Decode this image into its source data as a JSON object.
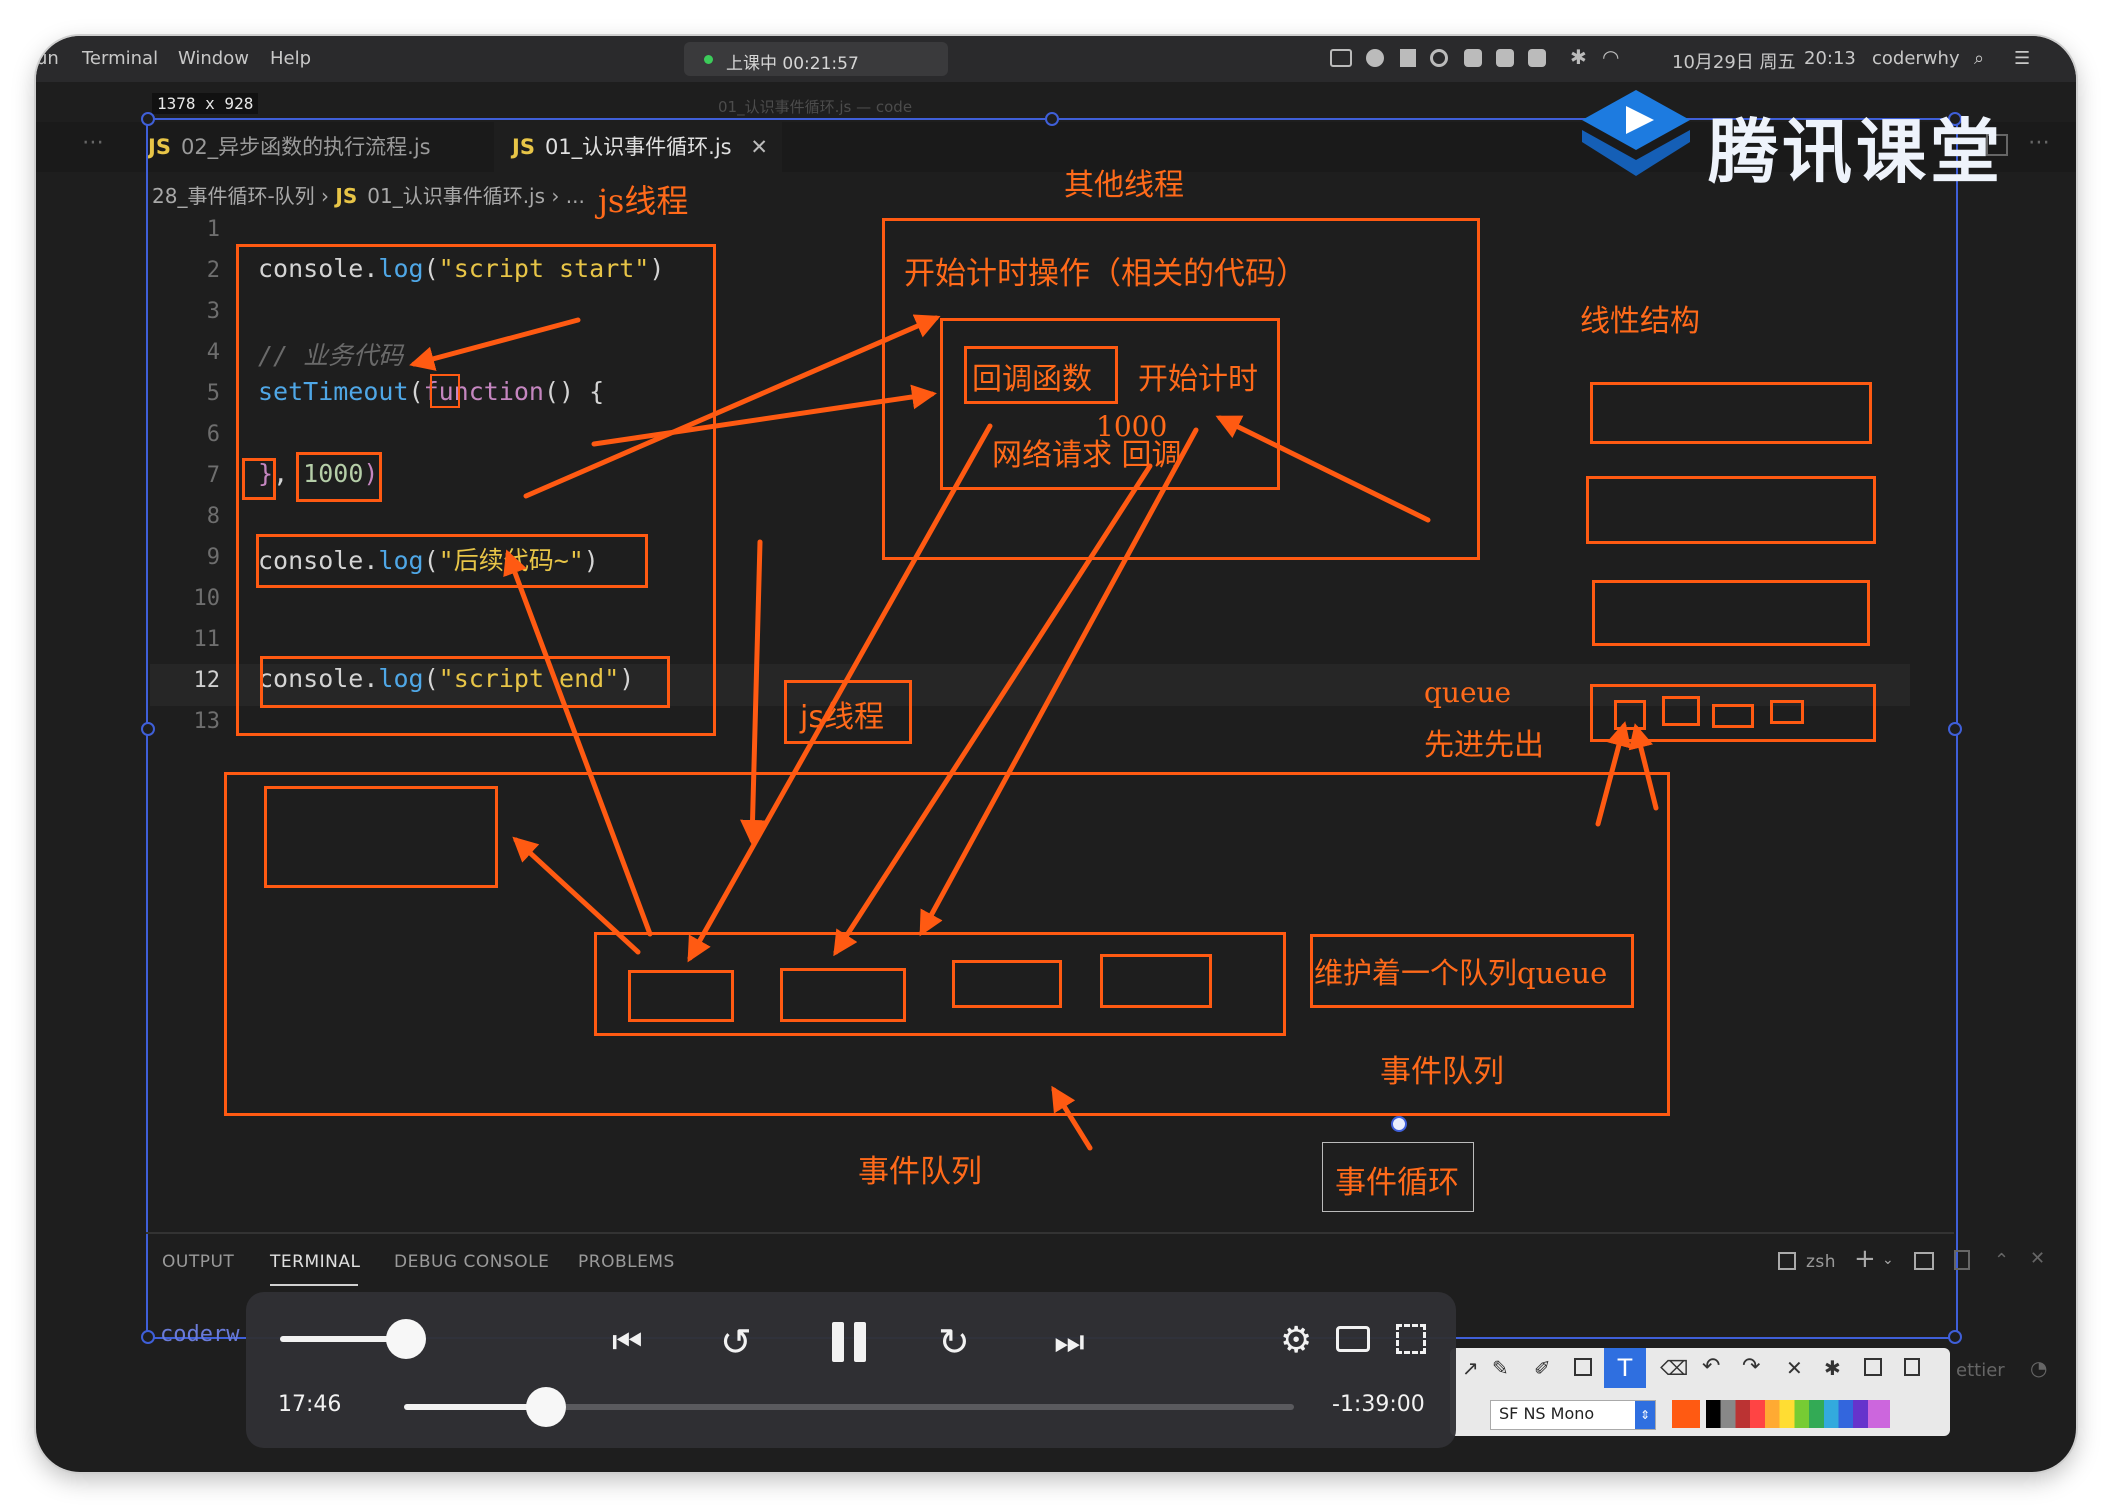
{
  "menubar": {
    "partial_left": "un",
    "terminal": "Terminal",
    "window": "Window",
    "help": "Help",
    "recording": "上课中 00:21:57",
    "date": "10月29日 周五",
    "time": "20:13",
    "user": "coderwhy"
  },
  "window_title": "01_认识事件循环.js — code",
  "canvas_size": "1378 x 928",
  "logo_text": "腾讯课堂",
  "editor": {
    "tabs": [
      {
        "label": "02_异步函数的执行流程.js"
      },
      {
        "label": "01_认识事件循环.js"
      }
    ],
    "breadcrumb": {
      "folder": "28_事件循环-队列",
      "file": "01_认识事件循环.js",
      "rest": "..."
    },
    "line_numbers": [
      "1",
      "2",
      "3",
      "4",
      "5",
      "6",
      "7",
      "8",
      "9",
      "10",
      "11",
      "12",
      "13"
    ],
    "code": {
      "l2_a": "console.",
      "l2_b": "log",
      "l2_c": "(",
      "l2_d": "\"script start\"",
      "l2_e": ")",
      "l4": "// 业务代码",
      "l5_a": "setTimeout",
      "l5_b": "(",
      "l5_c": "function",
      "l5_d": "() {",
      "l7_a": "}",
      "l7_b": ", ",
      "l7_c": "1000",
      "l7_d": ")",
      "l9_a": "console.",
      "l9_b": "log",
      "l9_c": "(",
      "l9_d": "\"后续代码~\"",
      "l9_e": ")",
      "l12_a": "console.",
      "l12_b": "log",
      "l12_c": "(",
      "l12_d": "\"script end\"",
      "l12_e": ")"
    }
  },
  "annotations": {
    "js_thread_top": "js线程",
    "other_threads": "其他线程",
    "timer_op": "开始计时操作（相关的代码）",
    "callback": "回调函数",
    "start_timer": "开始计时",
    "n1000": "1000",
    "network_callback": "网络请求 回调",
    "linear": "线性结构",
    "queue": "queue",
    "fifo": "先进先出",
    "js_thread_mid": "js线程",
    "maintain_queue": "维护着一个队列queue",
    "event_queue_right": "事件队列",
    "event_queue_bottom": "事件队列",
    "event_loop": "事件循环"
  },
  "panel": {
    "tabs": [
      "OUTPUT",
      "TERMINAL",
      "DEBUG CONSOLE",
      "PROBLEMS"
    ],
    "active_tab": "TERMINAL",
    "shell": "zsh",
    "prompt": "coderw"
  },
  "player": {
    "elapsed": "17:46",
    "remaining": "-1:39:00",
    "progress": 0.16,
    "volume": 0.9
  },
  "drawing_toolbar": {
    "font": "SF NS Mono",
    "partial_text": "ettier"
  },
  "colors": {
    "annotation": "#ff5a12",
    "selection": "#3f5fd8",
    "string": "#e8c547",
    "function": "#4fa7e6",
    "keyword": "#c586c0"
  }
}
